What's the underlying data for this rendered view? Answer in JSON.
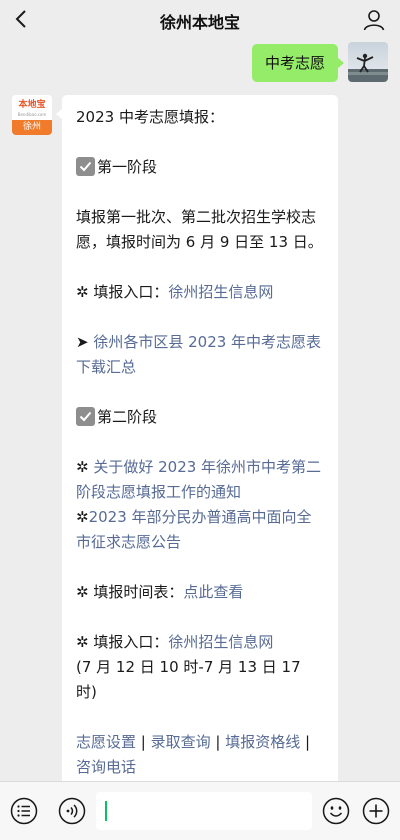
{
  "header": {
    "title": "徐州本地宝"
  },
  "user_message": {
    "text": "中考志愿"
  },
  "bot": {
    "avatar": {
      "brand": "本地宝",
      "domain": "Bendibao.com",
      "city": "徐州"
    }
  },
  "reply": {
    "intro": "2023 中考志愿填报：",
    "stage1_title": "第一阶段",
    "stage1_desc": "填报第一批次、第二批次招生学校志愿，填报时间为 6 月 9 日至 13 日。",
    "stage1_entry_label": "✲ 填报入口：",
    "stage1_entry_link": "徐州招生信息网",
    "stage1_download_prefix": "➤ ",
    "stage1_download_link": "徐州各市区县 2023 年中考志愿表下载汇总",
    "stage2_title": "第二阶段",
    "stage2_notice_prefix": "✲ ",
    "stage2_notice_link": "关于做好 2023 年徐州市中考第二阶段志愿填报工作的通知",
    "stage2_announce_prefix": "✲",
    "stage2_announce_link": "2023 年部分民办普通高中面向全市征求志愿公告",
    "stage2_schedule_label": "✲ 填报时间表：",
    "stage2_schedule_link": "点此查看",
    "stage2_entry_label": "✲ 填报入口：",
    "stage2_entry_link": "徐州招生信息网",
    "stage2_time": "(7 月 12 日 10 时-7 月 13 日 17 时)",
    "footer_links": [
      "志愿设置",
      "录取查询",
      "填报资格线",
      "咨询电话"
    ],
    "footer_sep": " | "
  },
  "input_bar": {
    "value": ""
  },
  "icons": {
    "back": "chevron-left-icon",
    "profile": "person-icon",
    "menu": "menu-list-icon",
    "voice": "voice-icon",
    "emoji": "emoji-icon",
    "more": "plus-icon"
  },
  "colors": {
    "background": "#ededed",
    "user_bubble": "#95ec69",
    "link": "#576b95",
    "caret": "#07c160"
  }
}
